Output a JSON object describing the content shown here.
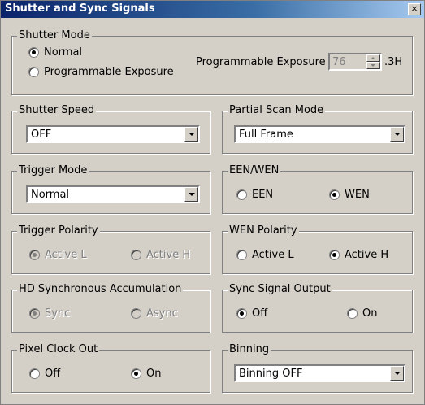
{
  "window": {
    "title": "Shutter and Sync Signals",
    "close_glyph": "×"
  },
  "shutter_mode": {
    "legend": "Shutter Mode",
    "normal": "Normal",
    "programmable": "Programmable Exposure",
    "selected": "Normal",
    "exposure_label": "Programmable Exposure",
    "exposure_value": "76",
    "exposure_unit": ".3H"
  },
  "shutter_speed": {
    "legend": "Shutter Speed",
    "value": "OFF"
  },
  "partial_scan": {
    "legend": "Partial Scan Mode",
    "value": "Full Frame"
  },
  "trigger_mode": {
    "legend": "Trigger Mode",
    "value": "Normal"
  },
  "een_wen": {
    "legend": "EEN/WEN",
    "een": "EEN",
    "wen": "WEN",
    "selected": "WEN"
  },
  "trigger_polarity": {
    "legend": "Trigger Polarity",
    "low": "Active L",
    "high": "Active H",
    "selected": "Active L"
  },
  "wen_polarity": {
    "legend": "WEN Polarity",
    "low": "Active L",
    "high": "Active H",
    "selected": "Active H"
  },
  "hd_sync": {
    "legend": "HD Synchronous Accumulation",
    "sync": "Sync",
    "async": "Async",
    "selected": "Sync"
  },
  "sync_output": {
    "legend": "Sync Signal Output",
    "off": "Off",
    "on": "On",
    "selected": "Off"
  },
  "pixel_clock": {
    "legend": "Pixel Clock Out",
    "off": "Off",
    "on": "On",
    "selected": "On"
  },
  "binning": {
    "legend": "Binning",
    "value": "Binning OFF"
  }
}
